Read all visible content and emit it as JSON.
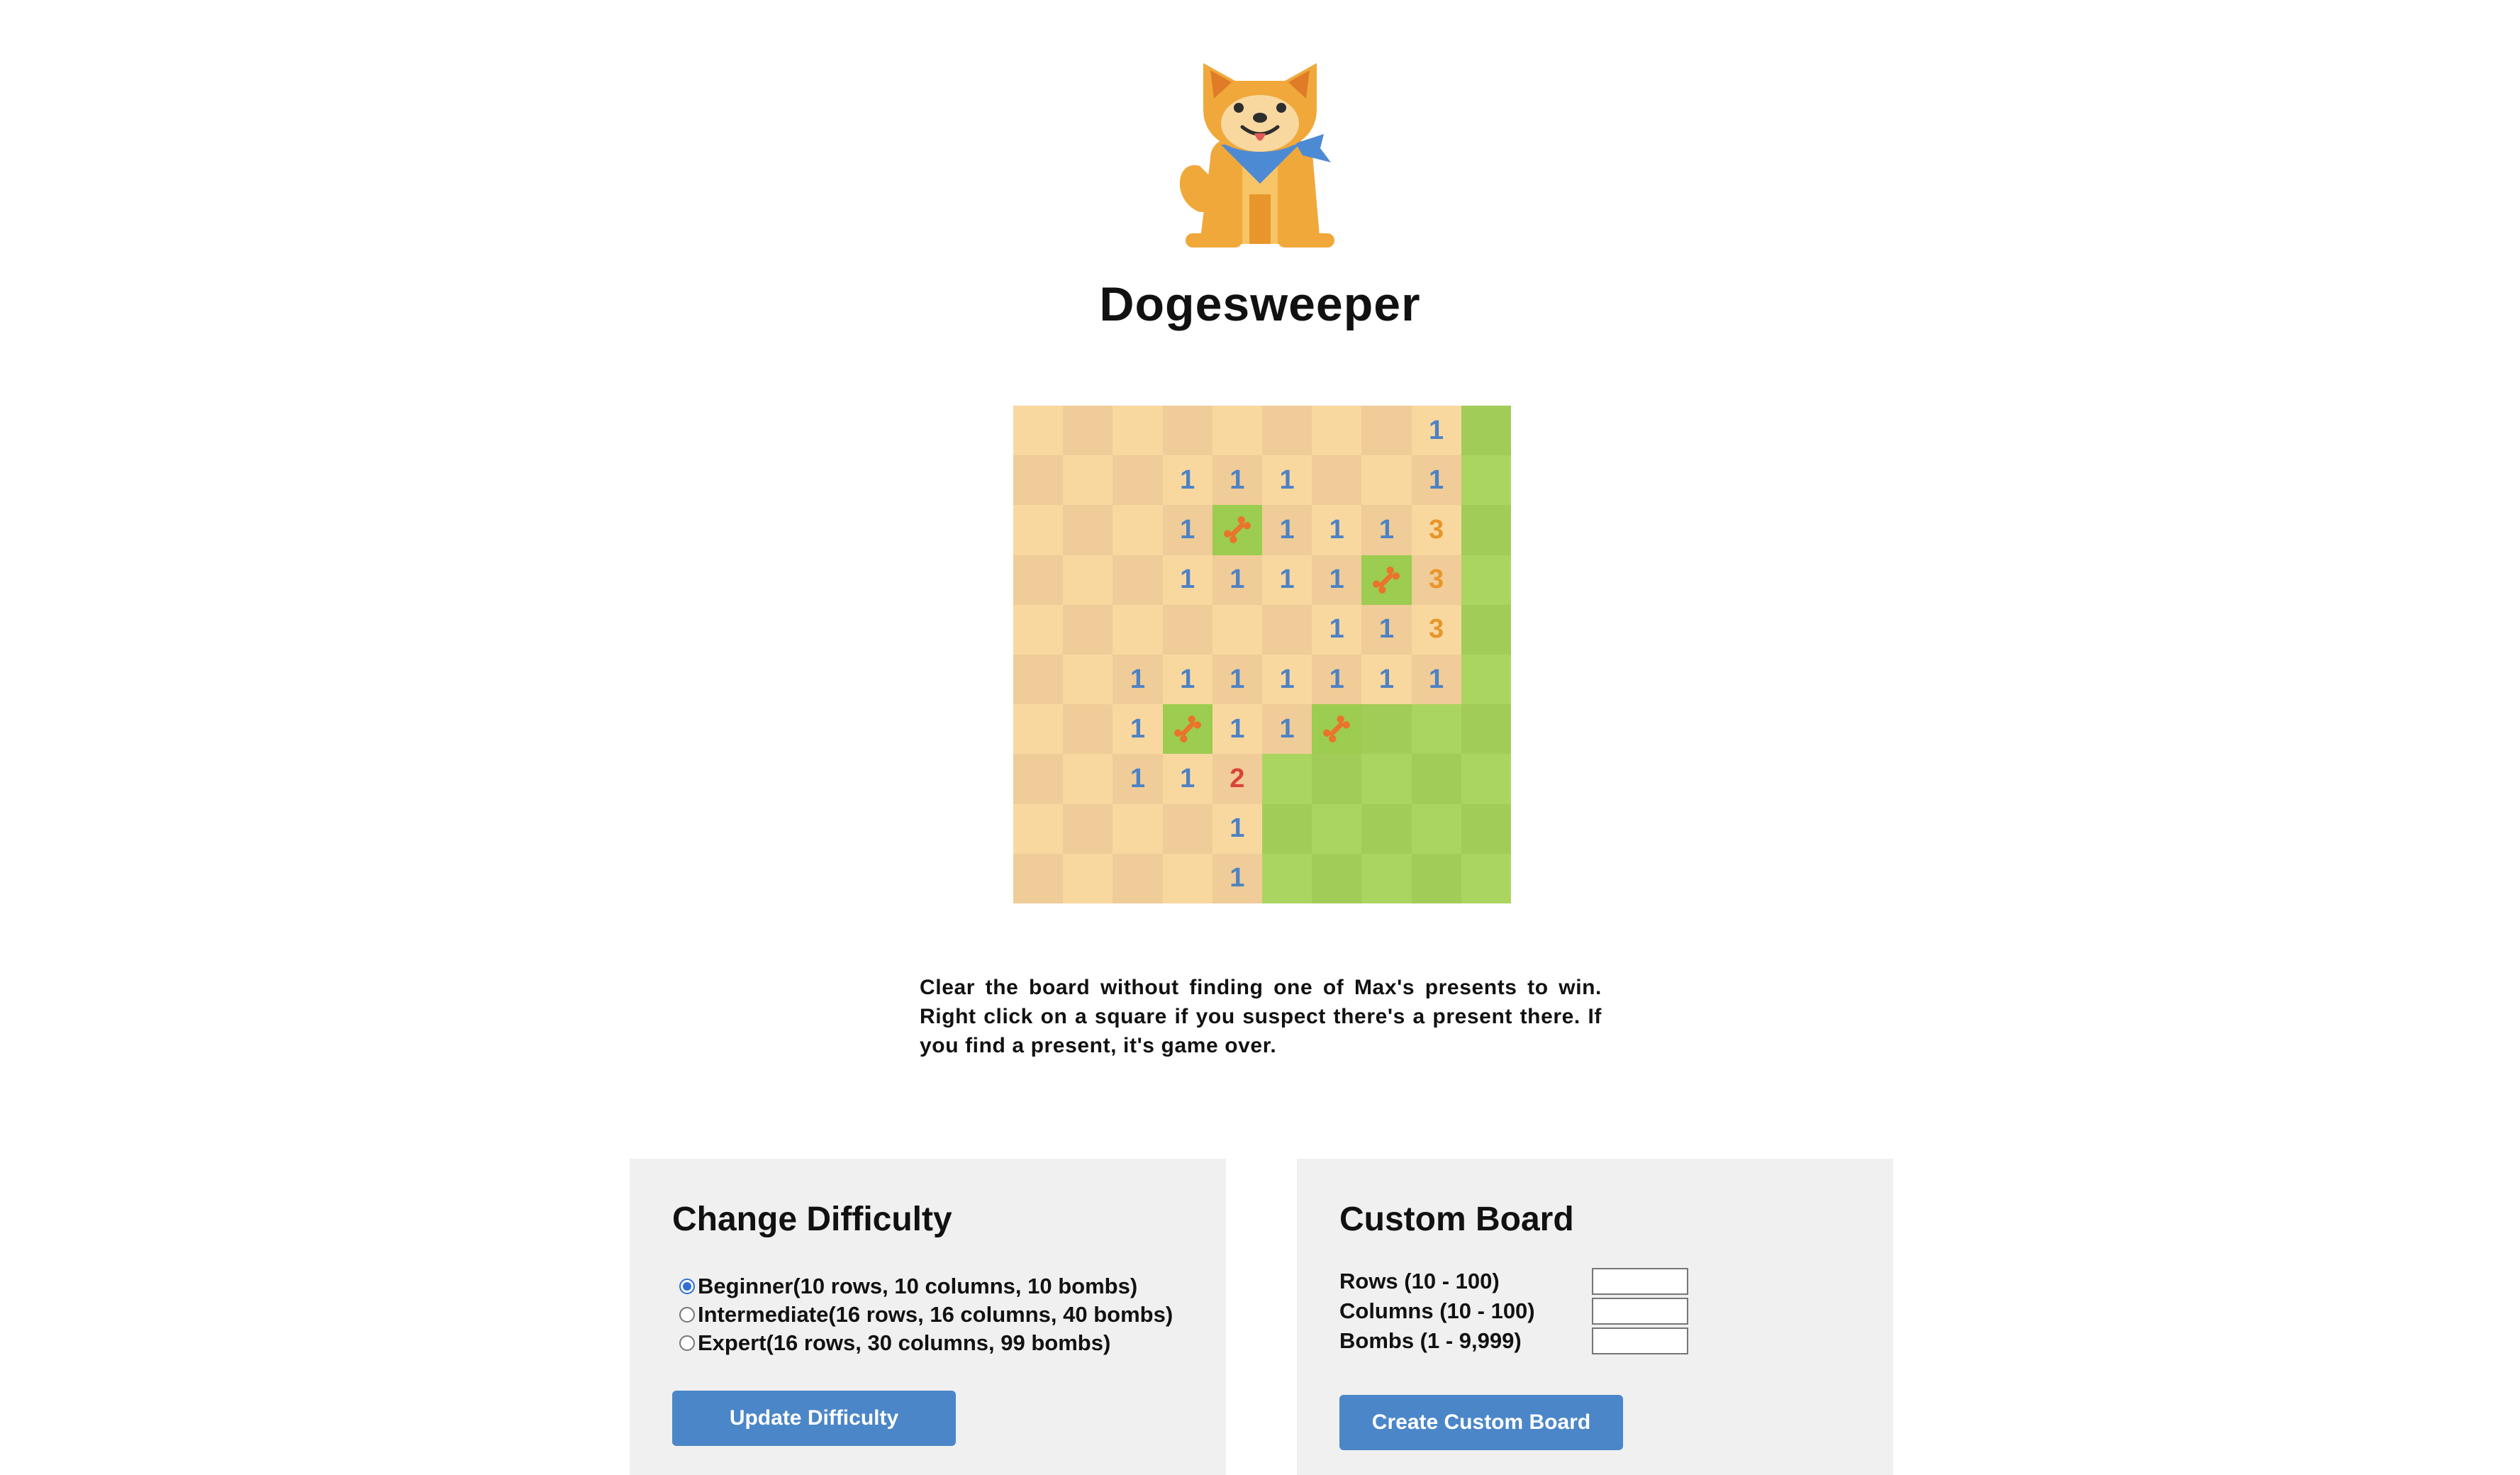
{
  "app": {
    "title": "Dogesweeper",
    "logo_icon": "shiba-dog-logo"
  },
  "board": {
    "rows": 10,
    "columns": 10,
    "colors": {
      "uncovered_light": "#f9d8a0",
      "uncovered_dark": "#f0cc98",
      "covered_light": "#aad560",
      "covered_dark": "#a2cc58",
      "number_1": "#4d82c4",
      "number_2": "#d9443b",
      "number_3": "#e8962b",
      "bone": "#e9742a"
    },
    "grid": [
      [
        "",
        "",
        "",
        "",
        "",
        "",
        "",
        "",
        "1",
        "#"
      ],
      [
        "",
        "",
        "",
        "1",
        "1",
        "1",
        "",
        "",
        "1",
        "#"
      ],
      [
        "",
        "",
        "",
        "1",
        "B",
        "1",
        "1",
        "1",
        "3",
        "#"
      ],
      [
        "",
        "",
        "",
        "1",
        "1",
        "1",
        "1",
        "B",
        "3",
        "#"
      ],
      [
        "",
        "",
        "",
        "",
        "",
        "",
        "1",
        "1",
        "3",
        "#"
      ],
      [
        "",
        "",
        "1",
        "1",
        "1",
        "1",
        "1",
        "1",
        "1",
        "#"
      ],
      [
        "",
        "",
        "1",
        "B",
        "1",
        "1",
        "B",
        "#",
        "#",
        "#"
      ],
      [
        "",
        "",
        "1",
        "1",
        "2",
        "#",
        "#",
        "#",
        "#",
        "#"
      ],
      [
        "",
        "",
        "",
        "",
        "1",
        "#",
        "#",
        "#",
        "#",
        "#"
      ],
      [
        "",
        "",
        "",
        "",
        "1",
        "#",
        "#",
        "#",
        "#",
        "#"
      ]
    ],
    "legend": {
      "empty": "",
      "covered": "#",
      "flagged": "B"
    }
  },
  "instructions": "Clear the board without finding one of Max's presents to win. Right click on a square if you suspect there's a present there. If you find a present, it's game over.",
  "difficulty_panel": {
    "heading": "Change Difficulty",
    "options": [
      {
        "label": "Beginner(10 rows, 10 columns, 10 bombs)",
        "checked": true
      },
      {
        "label": "Intermediate(16 rows, 16 columns, 40 bombs)",
        "checked": false
      },
      {
        "label": "Expert(16 rows, 30 columns, 99 bombs)",
        "checked": false
      }
    ],
    "button_label": "Update Difficulty"
  },
  "custom_panel": {
    "heading": "Custom Board",
    "fields": [
      {
        "label": "Rows (10 - 100)",
        "value": ""
      },
      {
        "label": "Columns (10 - 100)",
        "value": ""
      },
      {
        "label": "Bombs (1 - 9,999)",
        "value": ""
      }
    ],
    "button_label": "Create Custom Board"
  },
  "accent_color": "#4b86c8",
  "panel_background": "#f0f0f0"
}
